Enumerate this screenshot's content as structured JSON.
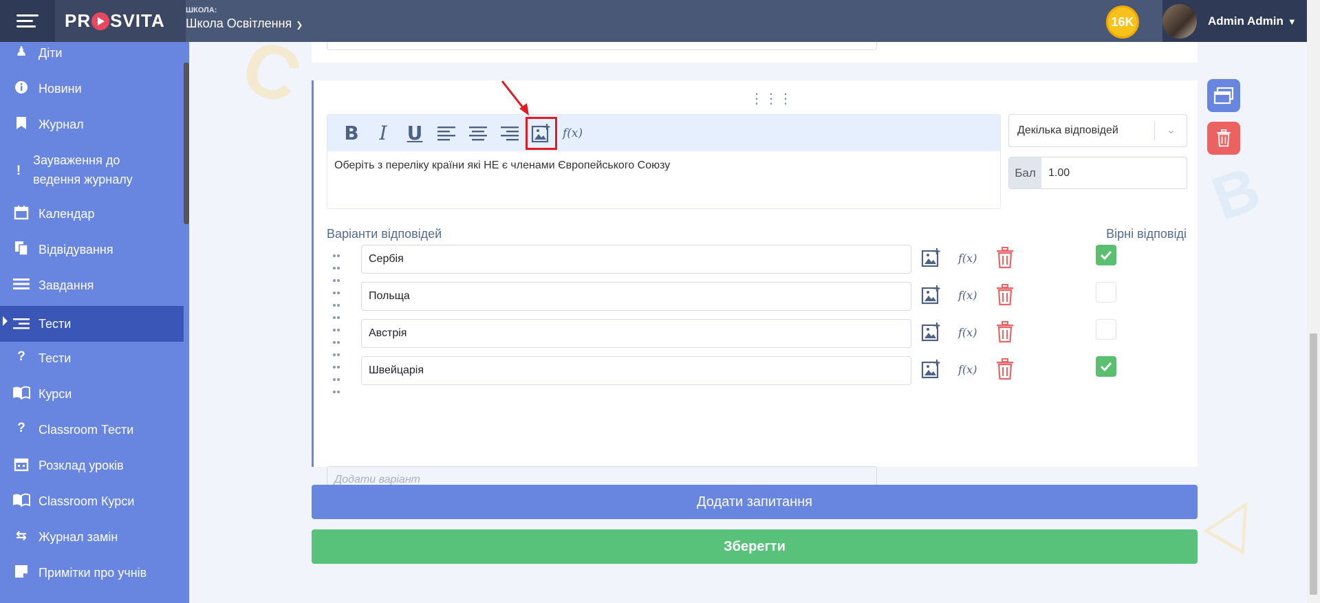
{
  "topbar": {
    "logo_prefix": "PR",
    "logo_suffix": "SVITA",
    "school_label": "ШКОЛА:",
    "school_name": "Школа Освітлення",
    "coins": "16K",
    "user_name": "Admin Admin"
  },
  "sidebar": {
    "items": [
      {
        "label": "Діти",
        "icon": "child-icon"
      },
      {
        "label": "Новини",
        "icon": "info-icon"
      },
      {
        "label": "Журнал",
        "icon": "bookmark-icon"
      },
      {
        "label": "Зауваження до ведення журналу",
        "icon": "exclamation-icon"
      },
      {
        "label": "Календар",
        "icon": "calendar-icon"
      },
      {
        "label": "Відвідування",
        "icon": "documents-icon"
      },
      {
        "label": "Завдання",
        "icon": "tasks-icon"
      },
      {
        "label": "Тести",
        "icon": "list-icon"
      },
      {
        "label": "Тести",
        "icon": "question-icon"
      },
      {
        "label": "Курси",
        "icon": "book-icon"
      },
      {
        "label": "Classroom Тести",
        "icon": "question-icon"
      },
      {
        "label": "Розклад уроків",
        "icon": "calendar-grid-icon"
      },
      {
        "label": "Classroom Курси",
        "icon": "book-icon"
      },
      {
        "label": "Журнал замін",
        "icon": "swap-icon"
      },
      {
        "label": "Примітки про учнів",
        "icon": "note-icon"
      }
    ]
  },
  "question": {
    "text": "Оберіть з переліку країни які НЕ є членами Європейського Союзу",
    "fx_label": "f(x)",
    "type_value": "Декілька відповідей",
    "score_label": "Бал",
    "score_value": "1.00",
    "answers_title": "Варіанти відповідей",
    "correct_title": "Вірні відповіді",
    "answers": [
      {
        "text": "Сербія",
        "correct": true
      },
      {
        "text": "Польща",
        "correct": false
      },
      {
        "text": "Австрія",
        "correct": false
      },
      {
        "text": "Швейцарія",
        "correct": true
      }
    ],
    "add_variant_placeholder": "Додати варіант"
  },
  "actions": {
    "add_question": "Додати запитання",
    "save": "Зберегти"
  },
  "colors": {
    "sidebar": "#6886e0",
    "active": "#3a57b8",
    "topbar": "#4a5877",
    "save": "#58c17a",
    "delete": "#ec6262",
    "highlight": "#e11b22"
  }
}
